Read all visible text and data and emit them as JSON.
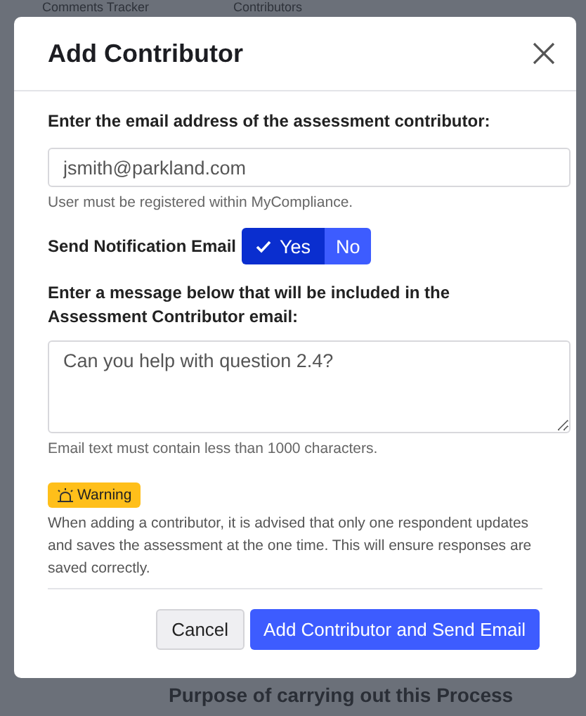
{
  "background": {
    "tabs": [
      {
        "label": "Comments Tracker"
      },
      {
        "label": "Contributors"
      }
    ],
    "heading": "Purpose of carrying out this Process"
  },
  "dialog": {
    "title": "Add Contributor",
    "email_label": "Enter the email address of the assessment contributor:",
    "email_value": "jsmith@parkland.com",
    "email_help": "User must be registered within MyCompliance.",
    "notify_label": "Send Notification Email",
    "notify_options": [
      {
        "label": "Yes",
        "selected": true
      },
      {
        "label": "No",
        "selected": false
      }
    ],
    "message_label": "Enter a message below that will be included in the Assessment Contributor email:",
    "message_value": "Can you help with question 2.4?",
    "message_help": "Email text must contain less than 1000 characters.",
    "warning_badge": "Warning",
    "warning_text": "When adding a contributor, it is advised that only one respondent updates and saves the assessment at the one time. This will ensure responses are saved correctly.",
    "buttons": [
      {
        "label": "Cancel",
        "kind": "secondary"
      },
      {
        "label": "Add Contributor and Send Email",
        "kind": "primary"
      }
    ]
  }
}
